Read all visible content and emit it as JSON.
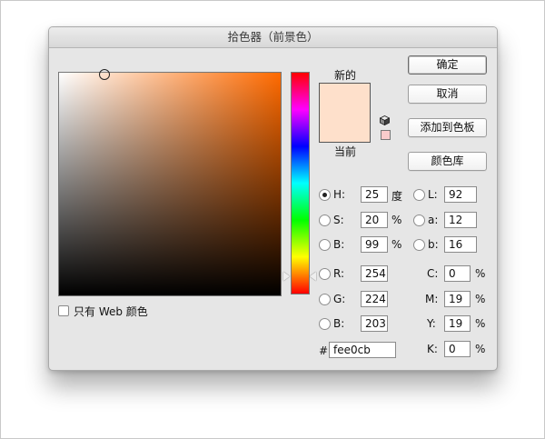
{
  "dialog": {
    "title": "拾色器（前景色）"
  },
  "swatch": {
    "new_label": "新的",
    "current_label": "当前",
    "new_color": "#fee0cb",
    "current_color": "#fee0cb"
  },
  "buttons": {
    "ok": "确定",
    "cancel": "取消",
    "add_to_swatches": "添加到色板",
    "color_libraries": "颜色库"
  },
  "web_only": {
    "label": "只有 Web 颜色",
    "checked": false
  },
  "hsb": {
    "h": {
      "label": "H:",
      "value": "25",
      "unit": "度",
      "selected": true
    },
    "s": {
      "label": "S:",
      "value": "20",
      "unit": "%",
      "selected": false
    },
    "b": {
      "label": "B:",
      "value": "99",
      "unit": "%",
      "selected": false
    }
  },
  "lab": {
    "l": {
      "label": "L:",
      "value": "92"
    },
    "a": {
      "label": "a:",
      "value": "12"
    },
    "b": {
      "label": "b:",
      "value": "16"
    }
  },
  "rgb": {
    "r": {
      "label": "R:",
      "value": "254"
    },
    "g": {
      "label": "G:",
      "value": "224"
    },
    "b": {
      "label": "B:",
      "value": "203"
    }
  },
  "cmyk": {
    "c": {
      "label": "C:",
      "value": "0",
      "unit": "%"
    },
    "m": {
      "label": "M:",
      "value": "19",
      "unit": "%"
    },
    "y": {
      "label": "Y:",
      "value": "19",
      "unit": "%"
    },
    "k": {
      "label": "K:",
      "value": "0",
      "unit": "%"
    }
  },
  "hex": {
    "label": "#",
    "value": "fee0cb"
  },
  "icons": {
    "gamut": "cube-icon"
  }
}
